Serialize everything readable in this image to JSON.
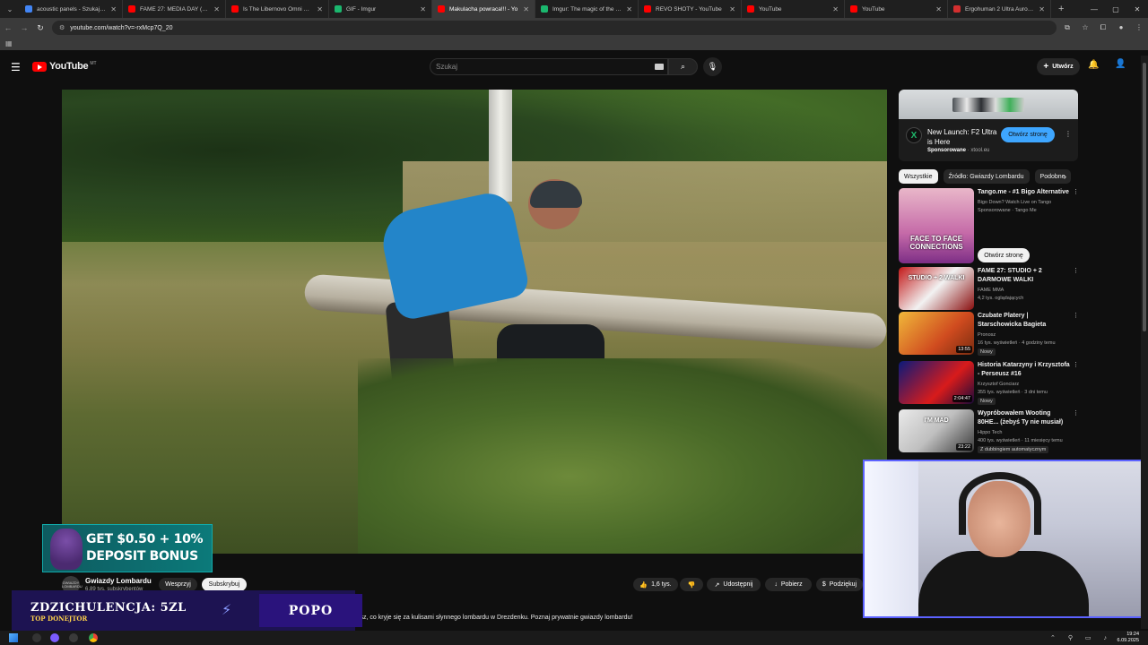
{
  "browser": {
    "tabs": [
      {
        "title": "acoustic panels - Szukaj w Go",
        "color": "#4285f4",
        "active": false
      },
      {
        "title": "FAME 27: MEDIA DAY (Media",
        "color": "#ff0000",
        "active": false
      },
      {
        "title": "Is The Libernovo Omni Chair",
        "color": "#ff0000",
        "active": false
      },
      {
        "title": "GIF - Imgur",
        "color": "#1bb76e",
        "active": false
      },
      {
        "title": "Makulacha powraca!!! - Yo",
        "color": "#ff0000",
        "active": true
      },
      {
        "title": "Imgur: The magic of the Inter",
        "color": "#1bb76e",
        "active": false
      },
      {
        "title": "REVO SHOTY - YouTube",
        "color": "#ff0000",
        "active": false
      },
      {
        "title": "YouTube",
        "color": "#ff0000",
        "active": false
      },
      {
        "title": "YouTube",
        "color": "#ff0000",
        "active": false
      },
      {
        "title": "Ergohuman 2 Ultra Aurora W",
        "color": "#d32f2f",
        "active": false
      }
    ],
    "url": "youtube.com/watch?v=-rxMcp7Q_20"
  },
  "youtube": {
    "logo_text": "YouTube",
    "logo_country": "MT",
    "search_placeholder": "Szukaj",
    "create_label": "Utwórz"
  },
  "video": {
    "channel_avatar_text": "GWIAZDY LOMBARDU",
    "channel_name": "Gwiazdy Lombardu",
    "subscribers": "6,89 tys. subskrybentów",
    "support_label": "Wesprzyj",
    "subscribe_label": "Subskrybuj",
    "likes": "1,6 tys.",
    "share_label": "Udostępnij",
    "download_label": "Pobierz",
    "thanks_label": "Podziękuj",
    "description_snippet": "u zobaczysz, co kryje się za kulisami słynnego lombardu w Drezdenku. Poznaj prywatnie gwiazdy lombardu!"
  },
  "overlay_ad": {
    "line1": "GET $0.50 + 10%",
    "line2": "DEPOSIT BONUS"
  },
  "donation": {
    "title": "ZDZICHULENCJA: 5ZL",
    "subtitle": "TOP DONEJTOR",
    "name": "POPO"
  },
  "sidebar_ad": {
    "logo_glyph": "X",
    "title": "New Launch: F2 Ultra is Here",
    "sponsored": "Sponsorowane",
    "domain": "xtool.eu",
    "cta": "Otwórz stronę"
  },
  "chips": [
    {
      "label": "Wszystkie",
      "active": true
    },
    {
      "label": "Źródło: Gwiazdy Lombardu",
      "active": false
    },
    {
      "label": "Podobne",
      "active": false
    }
  ],
  "recommendations": [
    {
      "title": "Tango.me - #1 Bigo Alternative",
      "channel": "Bigo Down? Watch Live on Tango",
      "meta": "Sponsorowane · Tango Me",
      "duration": "",
      "badge": "",
      "cta": "Otwórz stronę",
      "thumb_text": "FACE TO FACE CONNECTIONS"
    },
    {
      "title": "FAME 27: STUDIO + 2 DARMOWE WALKI",
      "channel": "FAME MMA",
      "meta": "4,2 tys. oglądających",
      "duration": "",
      "badge": "",
      "cta": "",
      "thumb_text": "STUDIO + 2 WALKI"
    },
    {
      "title": "Czubate Platery | Starschowicka Bagieta",
      "channel": "Pronosz",
      "meta": "16 tys. wyświetleń · 4 godziny temu",
      "duration": "13:55",
      "badge": "Nowy",
      "cta": "",
      "thumb_text": ""
    },
    {
      "title": "Historia Katarzyny i Krzysztofa - Perseusz #16",
      "channel": "Krzysztof Gonciarz",
      "meta": "355 tys. wyświetleń · 3 dni temu",
      "duration": "2:04:47",
      "badge": "Nowy",
      "cta": "",
      "thumb_text": ""
    },
    {
      "title": "Wypróbowałem Wooting 80HE... (żebyś Ty nie musiał)",
      "channel": "Hippo Tech",
      "meta": "400 tys. wyświetleń · 11 miesięcy temu",
      "duration": "23:22",
      "badge": "Z dubbingiem automatycznym",
      "cta": "",
      "thumb_text": "I'M MAD"
    }
  ],
  "taskbar": {
    "time": "19:24",
    "date": "6.09.2025"
  }
}
